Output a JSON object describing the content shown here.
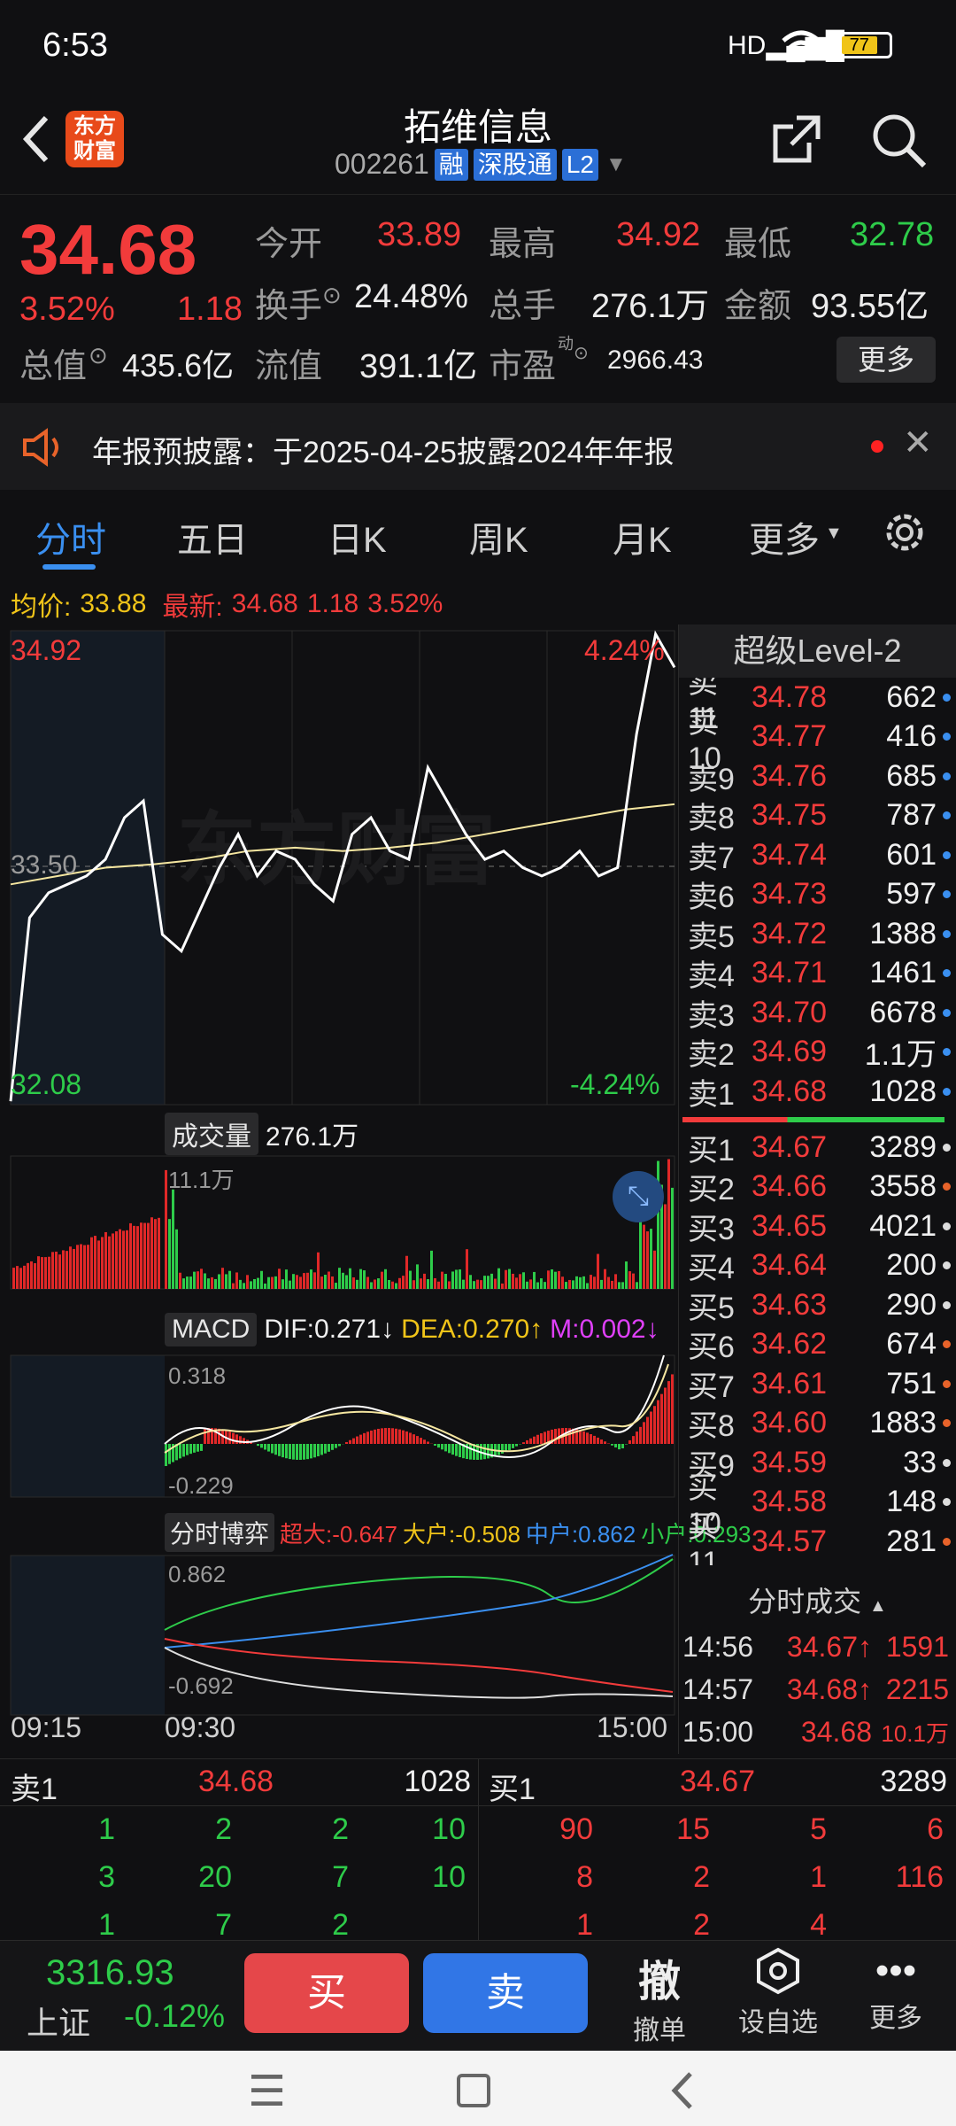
{
  "status": {
    "time": "6:53",
    "battery": "77"
  },
  "header": {
    "title": "拓维信息",
    "code": "002261",
    "tag_margin": "融",
    "tag_connect": "深股通",
    "tag_level": "L2",
    "logo": "东方\n财富"
  },
  "quote": {
    "price": "34.68",
    "pct": "3.52%",
    "chg": "1.18",
    "open_label": "今开",
    "open": "33.89",
    "high_label": "最高",
    "high": "34.92",
    "low_label": "最低",
    "low": "32.78",
    "turnover_label": "换手",
    "turnover": "24.48%",
    "vol_label": "总手",
    "vol": "276.1万",
    "amt_label": "金额",
    "amt": "93.55亿",
    "mcap_label": "总值",
    "mcap": "435.6亿",
    "float_label": "流值",
    "float": "391.1亿",
    "pe_label": "市盈",
    "pe_sup": "动",
    "pe": "2966.43",
    "more": "更多"
  },
  "notice": {
    "text": "年报预披露：于2025-04-25披露2024年年报"
  },
  "tabs": {
    "t1": "分时",
    "t2": "五日",
    "t3": "日K",
    "t4": "周K",
    "t5": "月K",
    "t6": "更多"
  },
  "chart_info": {
    "avg_label": "均价:",
    "avg": "33.88",
    "new_label": "最新:",
    "new": "34.68",
    "chg": "1.18",
    "pct": "3.52%",
    "y_top": "34.92",
    "y_bottom": "32.08",
    "pct_top": "4.24%",
    "pct_bottom": "-4.24%",
    "mid": "33.50",
    "watermark": "东方财富",
    "vol_btn": "成交量",
    "vol_value": "276.1万",
    "vol_max": "11.1万",
    "macd_btn": "MACD",
    "dif": "DIF:0.271↓",
    "dea": "DEA:0.270↑",
    "m": "M:0.002↓",
    "macd_max": "0.318",
    "macd_min": "-0.229",
    "game_btn": "分时博弈",
    "super": "超大:-0.647",
    "big": "大户:-0.508",
    "mid_lbl": "中户:0.862",
    "small": "小户:0.293",
    "game_max": "0.862",
    "game_min": "-0.692",
    "t_start": "09:15",
    "t_mid": "09:30",
    "t_end": "15:00"
  },
  "chart_data": {
    "type": "line",
    "title": "",
    "x_range": [
      "09:15",
      "15:00"
    ],
    "ylim": [
      32.08,
      34.92
    ],
    "series": [
      {
        "name": "",
        "values": [
          32.1,
          33.2,
          33.35,
          33.4,
          33.45,
          33.55,
          33.8,
          33.9,
          33.1,
          33.0,
          33.25,
          33.5,
          33.7,
          33.45,
          33.6,
          33.55,
          33.4,
          33.3,
          33.7,
          33.8,
          33.6,
          33.55,
          34.1,
          33.9,
          33.7,
          33.55,
          33.6,
          33.5,
          33.45,
          33.5,
          33.6,
          33.45,
          33.5,
          34.3,
          34.9,
          34.7
        ]
      },
      {
        "name": "",
        "values": [
          33.4,
          33.45,
          33.5,
          33.52,
          33.55,
          33.6,
          33.62,
          33.6,
          33.62,
          33.65,
          33.7,
          33.75,
          33.8,
          33.85,
          33.88
        ]
      }
    ]
  },
  "orderbook": {
    "title": "超级Level-2",
    "asks": [
      {
        "l": "卖11",
        "p": "34.78",
        "v": "662"
      },
      {
        "l": "卖10",
        "p": "34.77",
        "v": "416"
      },
      {
        "l": "卖9",
        "p": "34.76",
        "v": "685"
      },
      {
        "l": "卖8",
        "p": "34.75",
        "v": "787"
      },
      {
        "l": "卖7",
        "p": "34.74",
        "v": "601"
      },
      {
        "l": "卖6",
        "p": "34.73",
        "v": "597"
      },
      {
        "l": "卖5",
        "p": "34.72",
        "v": "1388"
      },
      {
        "l": "卖4",
        "p": "34.71",
        "v": "1461"
      },
      {
        "l": "卖3",
        "p": "34.70",
        "v": "6678"
      },
      {
        "l": "卖2",
        "p": "34.69",
        "v": "1.1万"
      },
      {
        "l": "卖1",
        "p": "34.68",
        "v": "1028"
      }
    ],
    "bids": [
      {
        "l": "买1",
        "p": "34.67",
        "v": "3289"
      },
      {
        "l": "买2",
        "p": "34.66",
        "v": "3558"
      },
      {
        "l": "买3",
        "p": "34.65",
        "v": "4021"
      },
      {
        "l": "买4",
        "p": "34.64",
        "v": "200"
      },
      {
        "l": "买5",
        "p": "34.63",
        "v": "290"
      },
      {
        "l": "买6",
        "p": "34.62",
        "v": "674"
      },
      {
        "l": "买7",
        "p": "34.61",
        "v": "751"
      },
      {
        "l": "买8",
        "p": "34.60",
        "v": "1883"
      },
      {
        "l": "买9",
        "p": "34.59",
        "v": "33"
      },
      {
        "l": "买10",
        "p": "34.58",
        "v": "148"
      },
      {
        "l": "买11",
        "p": "34.57",
        "v": "281"
      }
    ],
    "ticks_title": "分时成交",
    "ticks": [
      {
        "t": "14:56",
        "p": "34.67↑",
        "v": "1591"
      },
      {
        "t": "14:57",
        "p": "34.68↑",
        "v": "2215"
      },
      {
        "t": "15:00",
        "p": "34.68",
        "v": "10.1万"
      }
    ]
  },
  "queue": {
    "ask_label": "卖1",
    "ask_price": "34.68",
    "ask_vol": "1028",
    "bid_label": "买1",
    "bid_price": "34.67",
    "bid_vol": "3289",
    "ask_rows": [
      [
        "1",
        "2",
        "2",
        "10"
      ],
      [
        "3",
        "20",
        "7",
        "10"
      ],
      [
        "1",
        "7",
        "2",
        ""
      ]
    ],
    "bid_rows": [
      [
        "90",
        "15",
        "5",
        "6"
      ],
      [
        "8",
        "2",
        "1",
        "116"
      ],
      [
        "1",
        "2",
        "4",
        ""
      ]
    ]
  },
  "bottom": {
    "index": "3316.93",
    "index_name": "上证",
    "index_pct": "-0.12%",
    "buy": "买",
    "sell": "卖",
    "cancel": "撤",
    "cancel_lbl": "撤单",
    "fav_lbl": "设自选",
    "more_lbl": "更多"
  }
}
